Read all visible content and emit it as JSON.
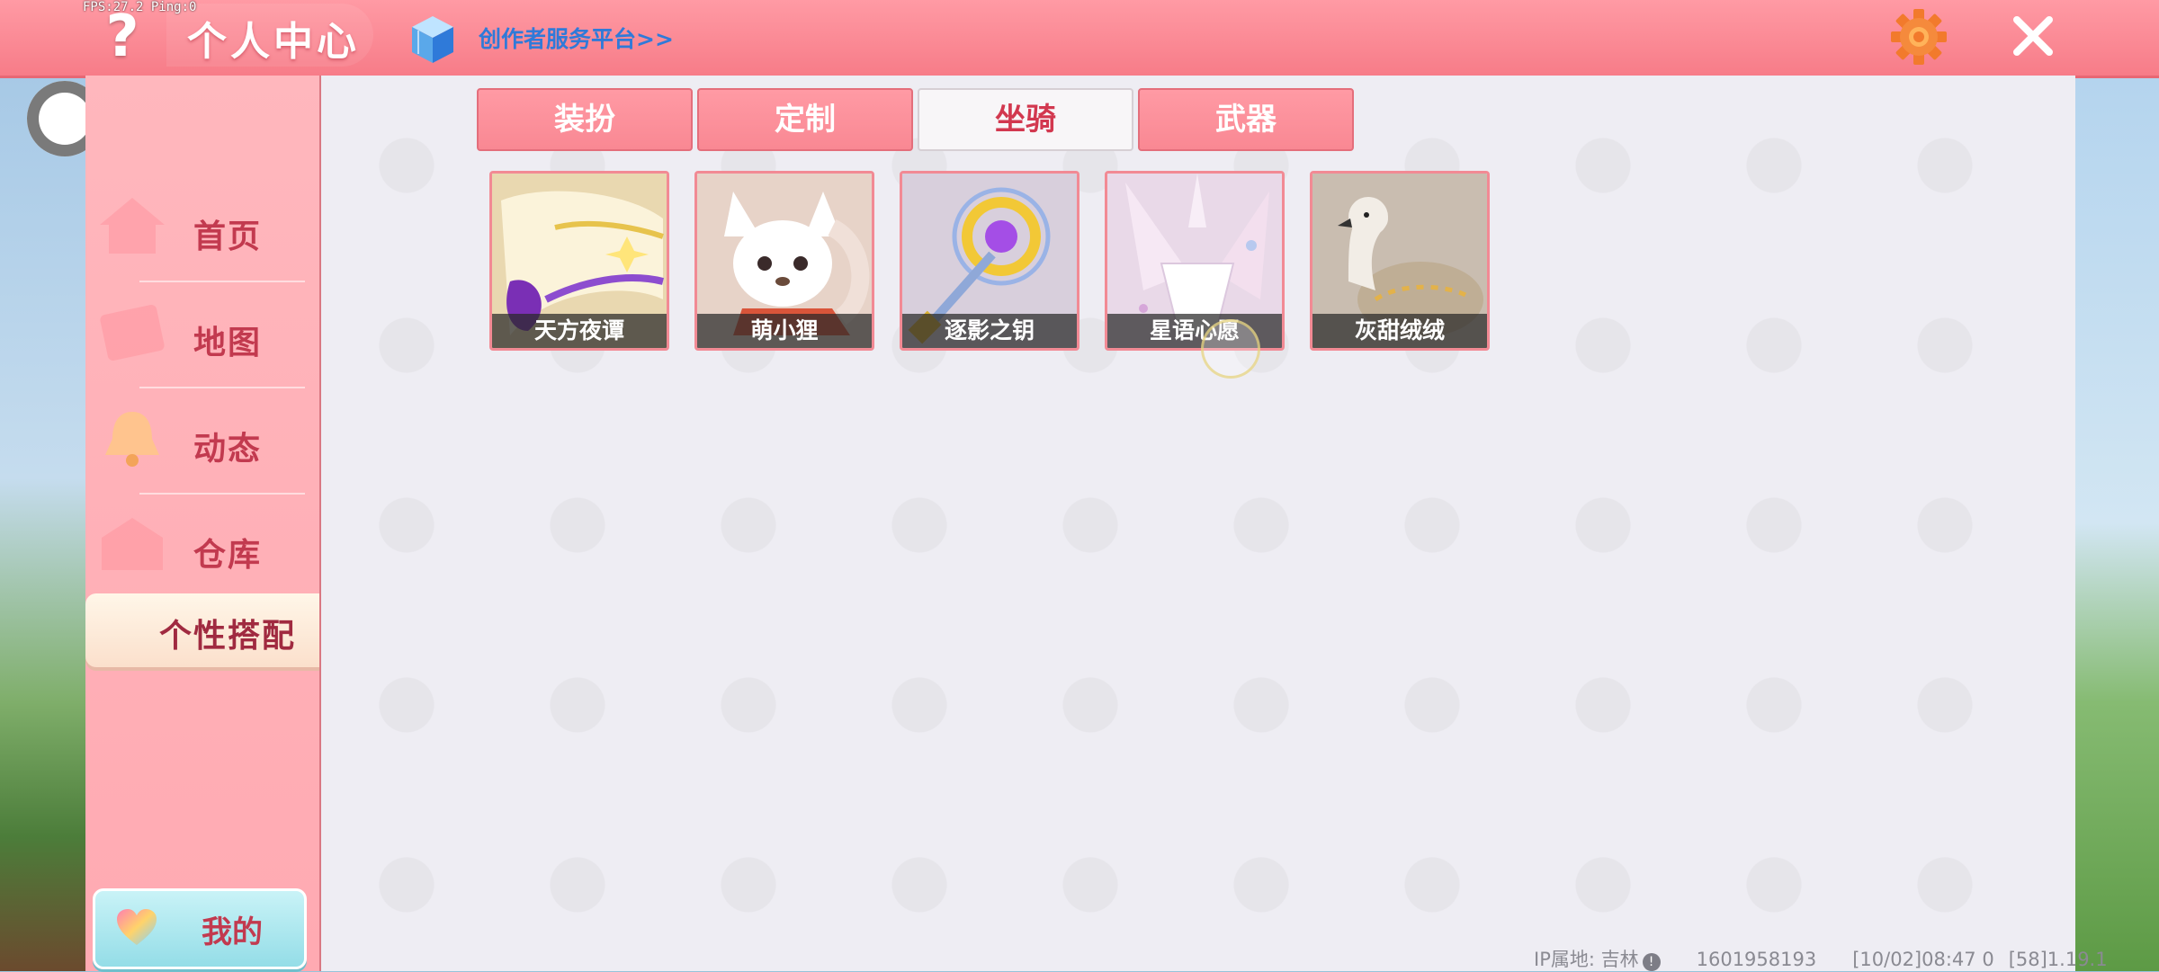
{
  "hud": {
    "fps": "FPS:27.2  Ping:0"
  },
  "header": {
    "help_glyph": "?",
    "title": "个人中心",
    "creator_link": "创作者服务平台>>"
  },
  "sidebar": {
    "items": [
      {
        "label": "首页"
      },
      {
        "label": "地图"
      },
      {
        "label": "动态"
      },
      {
        "label": "仓库"
      },
      {
        "label": "个性搭配"
      }
    ],
    "mine_button": "我的"
  },
  "tabs": [
    {
      "label": "装扮",
      "active": false
    },
    {
      "label": "定制",
      "active": false
    },
    {
      "label": "坐骑",
      "active": true
    },
    {
      "label": "武器",
      "active": false
    }
  ],
  "items": [
    {
      "name": "天方夜谭",
      "icon": "scroll-carpet-icon"
    },
    {
      "name": "萌小狸",
      "icon": "fox-mount-icon"
    },
    {
      "name": "逐影之钥",
      "icon": "magic-key-icon"
    },
    {
      "name": "星语心愿",
      "icon": "paper-crane-icon"
    },
    {
      "name": "灰甜绒绒",
      "icon": "swan-mount-icon"
    }
  ],
  "status_bar": {
    "ip_location": "IP属地: 吉林",
    "info_glyph": "!",
    "user_id": "1601958193",
    "time": "[10/02]08:47 0",
    "version": "[58]1.19.1"
  },
  "colors": {
    "accent": "#f77c88",
    "tab_active_text": "#d2384f",
    "sidebar_text": "#c23a4f",
    "link": "#2f7ad9"
  }
}
